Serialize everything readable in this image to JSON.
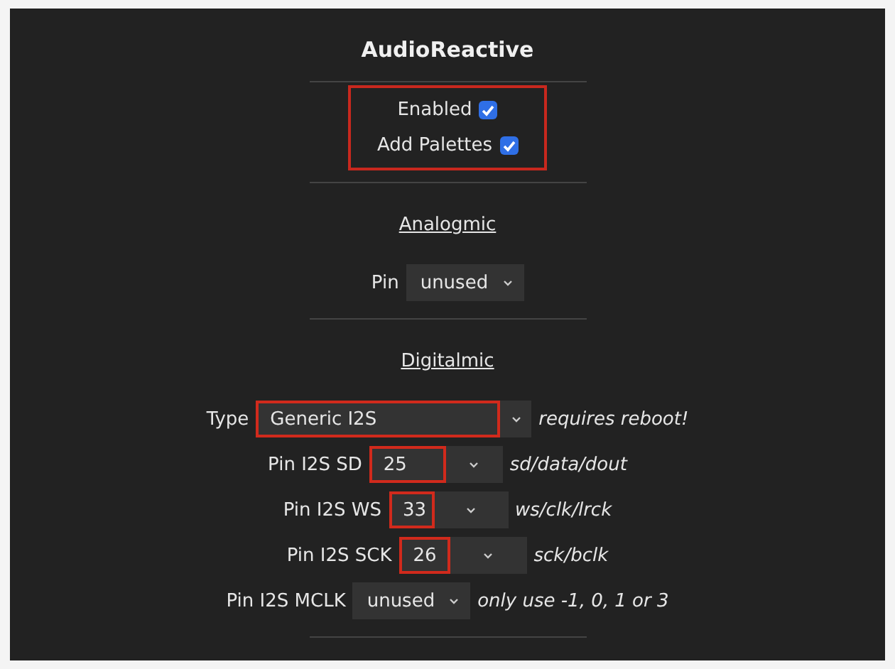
{
  "title": "AudioReactive",
  "options": {
    "highlighted": true,
    "items": [
      {
        "label": "Enabled",
        "checked": true
      },
      {
        "label": "Add Palettes",
        "checked": true
      }
    ]
  },
  "sections": [
    {
      "heading": "Analogmic",
      "fields": [
        {
          "label": "Pin",
          "value": "unused",
          "highlighted": false
        }
      ]
    },
    {
      "heading": "Digitalmic",
      "fields": [
        {
          "label": "Type",
          "value": "Generic I2S",
          "highlighted": true,
          "note": "requires reboot!"
        },
        {
          "label": "Pin I2S SD",
          "value": "25",
          "highlighted": true,
          "note": "sd/data/dout"
        },
        {
          "label": "Pin I2S WS",
          "value": "33",
          "highlighted": true,
          "note": "ws/clk/lrck"
        },
        {
          "label": "Pin I2S SCK",
          "value": "26",
          "highlighted": true,
          "note": "sck/bclk"
        },
        {
          "label": "Pin I2S MCLK",
          "value": "unused",
          "highlighted": false,
          "note": "only use -1, 0, 1 or 3"
        }
      ]
    }
  ]
}
